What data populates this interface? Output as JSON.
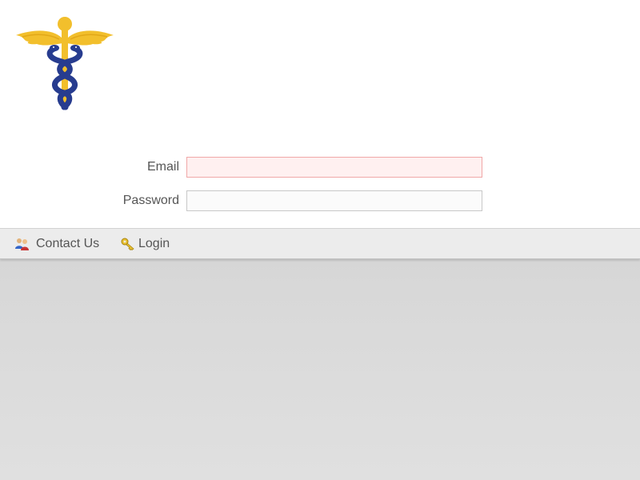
{
  "logo": {
    "icon": "caduceus-icon",
    "colors": {
      "wings": "#f2bf2c",
      "staff": "#f2bf2c",
      "serpents": "#273c8f"
    }
  },
  "form": {
    "email": {
      "label": "Email",
      "value": "",
      "placeholder": "",
      "invalid": true
    },
    "password": {
      "label": "Password",
      "value": "",
      "placeholder": ""
    }
  },
  "nav": {
    "items": [
      {
        "label": "Contact Us",
        "icon": "contact-users-icon"
      },
      {
        "label": "Login",
        "icon": "key-icon"
      }
    ]
  },
  "colors": {
    "label_text": "#555555",
    "invalid_border": "#f0a8a8",
    "invalid_background": "#fff0f0",
    "navbar_background": "#ececec",
    "page_background": "#d0d0d0"
  }
}
